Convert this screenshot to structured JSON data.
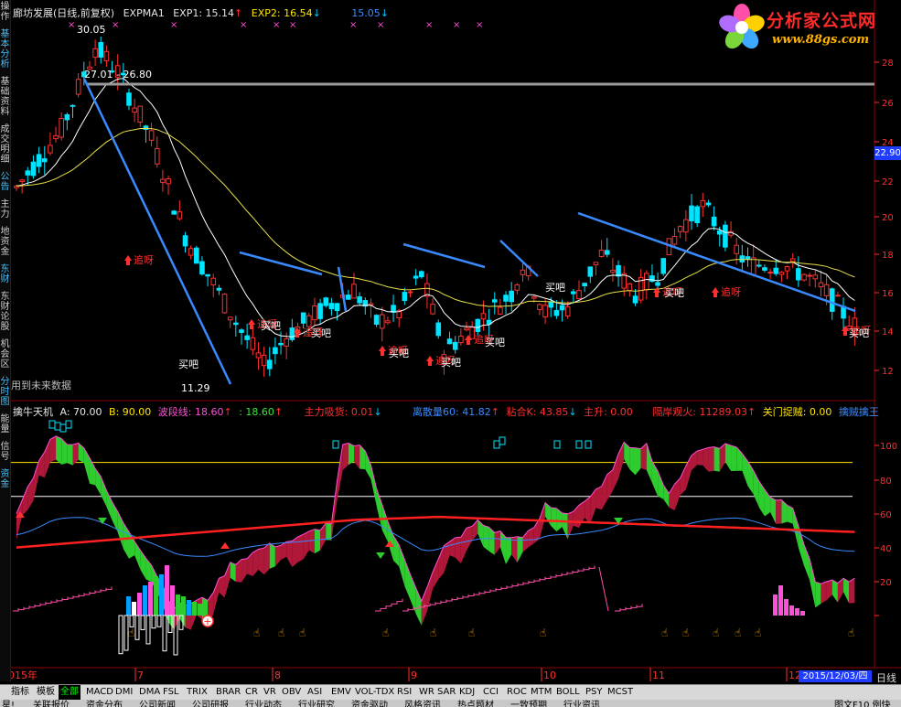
{
  "header": {
    "stock_title": "廊坊发展(日线,前复权)",
    "indicator": "EXPMA1",
    "exp1_label": "EXP1: 15.14",
    "exp1_arrow": "↑",
    "exp2_label": "EXP2: 16.54",
    "exp2_arrow": "↓",
    "extra_value": "15.05",
    "extra_arrow": "↓"
  },
  "logo": {
    "title": "分析家公式网",
    "url": "www.88gs.com"
  },
  "main_chart": {
    "price_high_label": "30.05",
    "range_label": "27.01 - 26.80",
    "low_label": "11.29",
    "future_data_label": "用到未来数据",
    "current_price_box": "22.90",
    "y_ticks": [
      "28",
      "26",
      "24",
      "22",
      "20",
      "18",
      "16",
      "14",
      "12"
    ],
    "signal_chase": "追呀",
    "signal_buy": "买吧",
    "colors": {
      "up": "#ff3030",
      "down": "#00e5ff",
      "ma_short": "#ffffff",
      "ma_long": "#e6e04a",
      "trend": "#3a8aff"
    }
  },
  "sub_chart": {
    "name": "擒牛天机",
    "a_label": "A: 70.00",
    "b_label": "B: 90.00",
    "wave_label": "波段线: 18.60",
    "wave_arrow": "↑",
    "value2_label": ": 18.60",
    "value2_arrow": "↑",
    "absorb_label": "主力吸货: 0.01",
    "absorb_arrow": "↓",
    "dispersion_label": "离散量60: 41.82",
    "dispersion_arrow": "↑",
    "bond_label": "粘合K: 43.85",
    "bond_arrow": "↓",
    "rise_label": "主升: 0.00",
    "watch_label": "隔岸观火: 11289.03",
    "watch_arrow": "↑",
    "guard_label": "关门捉贼: 0.00",
    "capture_label": "擒贼擒王",
    "y_ticks": [
      "100",
      "80",
      "60",
      "40",
      "20"
    ]
  },
  "date_axis": {
    "year_label": "2015年",
    "months": [
      "7",
      "8",
      "9",
      "10",
      "11",
      "12"
    ],
    "current_date": "2015/12/03/四",
    "period": "日线"
  },
  "left_sidebar": {
    "items": [
      "操作",
      "基本分析",
      "基础资料",
      "成交明细",
      "公告",
      "主力",
      "地资金",
      "东财",
      "东财论股",
      "机会区",
      "分时图",
      "能量",
      "信号",
      "资金"
    ]
  },
  "tabs": [
    "指标",
    "模板",
    "全部",
    "MACD",
    "DMI",
    "DMA",
    "FSL",
    "TRIX",
    "BRAR",
    "CR",
    "VR",
    "OBV",
    "ASI",
    "EMV",
    "VOL-TDX",
    "RSI",
    "WR",
    "SAR",
    "KDJ",
    "CCI",
    "ROC",
    "MTM",
    "BOLL",
    "PSY",
    "MCST"
  ],
  "active_tab": "全部",
  "bottom_bar": {
    "items": [
      "星!",
      "关联报价",
      "资金分布",
      "公司新闻",
      "公司研报",
      "行业动态",
      "行业研究",
      "资金驱动",
      "风格资讯",
      "热点题材",
      "一致预期",
      "行业资讯"
    ],
    "right": "图文F10 例快"
  }
}
